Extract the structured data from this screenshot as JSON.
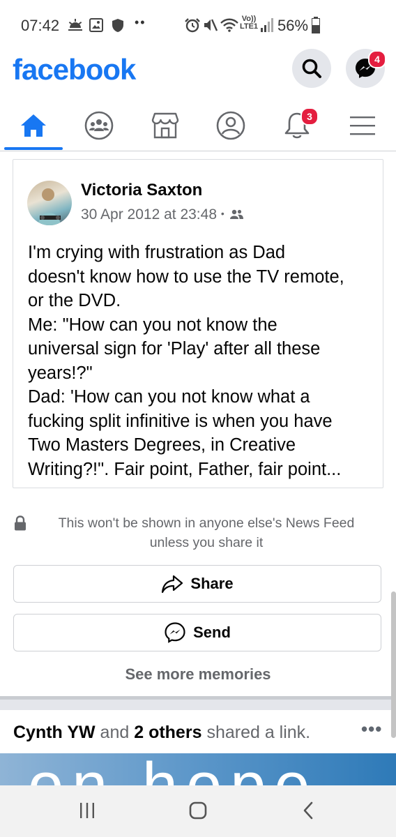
{
  "status_bar": {
    "time": "07:42",
    "battery": "56%",
    "network": "LTE1",
    "icons": [
      "weather-icon",
      "gallery-icon",
      "shield-icon",
      "more-dots-icon",
      "alarm-icon",
      "mute-icon",
      "wifi-icon",
      "volte-icon",
      "signal-icon",
      "battery-icon"
    ]
  },
  "header": {
    "logo": "facebook",
    "messenger_badge": "4"
  },
  "tabs": [
    {
      "name": "home",
      "icon": "home-icon",
      "active": true
    },
    {
      "name": "groups",
      "icon": "groups-icon"
    },
    {
      "name": "marketplace",
      "icon": "marketplace-icon"
    },
    {
      "name": "profile",
      "icon": "profile-icon"
    },
    {
      "name": "notifications",
      "icon": "bell-icon",
      "badge": "3"
    },
    {
      "name": "menu",
      "icon": "hamburger-icon"
    }
  ],
  "memory": {
    "author": "Victoria Saxton",
    "date": "30 Apr 2012 at 23:48",
    "separator": "•",
    "audience_icon": "friends-icon",
    "text_lines": [
      "I'm crying with frustration as Dad",
      "doesn't know how to use the TV remote,",
      "or the DVD.",
      "Me: \"How can you not know the",
      "universal sign for 'Play' after all these",
      "years!?\"",
      "Dad: 'How can you not know what a",
      "fucking split infinitive is when you have",
      "Two Masters Degrees, in Creative",
      "Writing?!\". Fair point, Father, fair point..."
    ]
  },
  "privacy_note": {
    "line1": "This won't be shown in anyone else's News Feed",
    "line2": "unless you share it"
  },
  "buttons": {
    "share": "Share",
    "send": "Send",
    "see_more": "See more memories"
  },
  "next_post": {
    "actor": "Cynth YW",
    "and": "and",
    "others": "2 others",
    "action": "shared a link.",
    "more": "•••",
    "preview_text": "on hope"
  },
  "colors": {
    "brand": "#1877f2",
    "badge": "#e41e3f",
    "secondary_text": "#65676b"
  }
}
